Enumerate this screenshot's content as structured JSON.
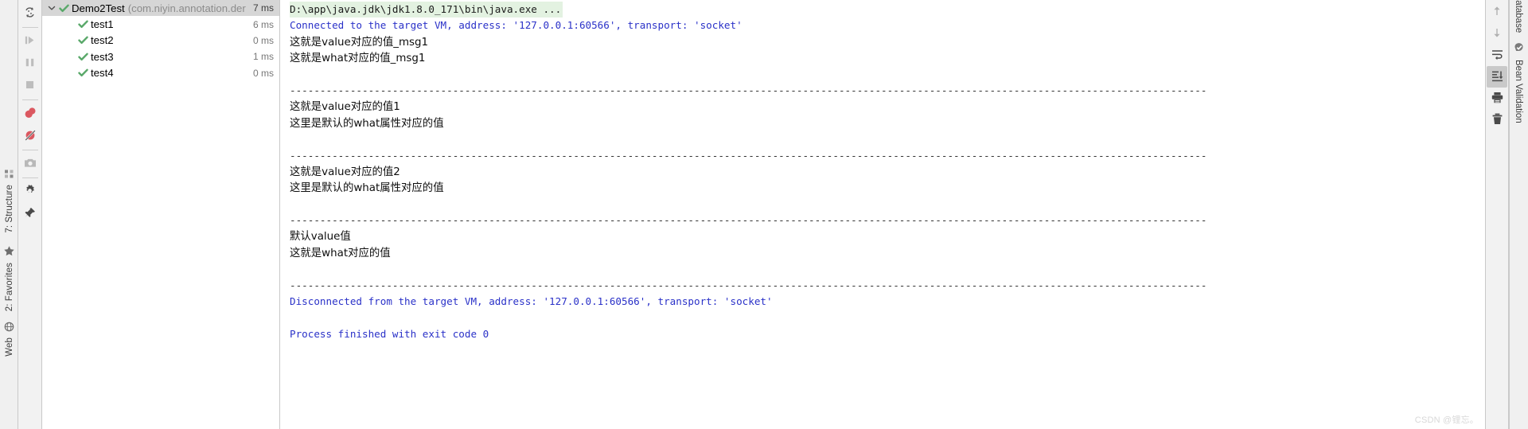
{
  "left_rail": {
    "tabs": [
      {
        "label": "7: Structure",
        "icon": "structure-icon"
      },
      {
        "label": "2: Favorites",
        "icon": "star-icon"
      },
      {
        "label": "Web",
        "icon": "web-icon"
      }
    ]
  },
  "run_toolbar": {
    "buttons": [
      {
        "name": "rerun-tests-button",
        "icon": "rerun-icon",
        "title": "Rerun"
      },
      {
        "name": "run-next-failed-button",
        "icon": "play-pause-icon",
        "title": "Resume Program"
      },
      {
        "name": "pause-button",
        "icon": "pause-icon",
        "title": "Pause Output"
      },
      {
        "name": "stop-button",
        "icon": "stop-icon",
        "title": "Stop"
      },
      {
        "name": "toggle-breakpoints-button",
        "icon": "breakpoints-icon",
        "title": "View Breakpoints"
      },
      {
        "name": "mute-breakpoints-button",
        "icon": "mute-breakpoints-icon",
        "title": "Mute Breakpoints"
      },
      {
        "name": "export-snapshot-button",
        "icon": "camera-icon",
        "title": "Export Test Results"
      },
      {
        "name": "settings-button",
        "icon": "gear-icon",
        "title": "Settings"
      },
      {
        "name": "pin-tab-button",
        "icon": "pin-icon",
        "title": "Pin Tab"
      }
    ]
  },
  "test_tree": {
    "rows": [
      {
        "name": "Demo2Test",
        "package": "(com.niyin.annotation.der",
        "time": "7 ms",
        "status": "passed",
        "selected": true,
        "expanded": true,
        "level": 0
      },
      {
        "name": "test1",
        "package": "",
        "time": "6 ms",
        "status": "passed",
        "selected": false,
        "level": 1
      },
      {
        "name": "test2",
        "package": "",
        "time": "0 ms",
        "status": "passed",
        "selected": false,
        "level": 1
      },
      {
        "name": "test3",
        "package": "",
        "time": "1 ms",
        "status": "passed",
        "selected": false,
        "level": 1
      },
      {
        "name": "test4",
        "package": "",
        "time": "0 ms",
        "status": "passed",
        "selected": false,
        "level": 1
      }
    ]
  },
  "console": {
    "lines": [
      {
        "text": "D:\\app\\java.jdk\\jdk1.8.0_171\\bin\\java.exe ...",
        "style": "cmd"
      },
      {
        "text": "Connected to the target VM, address: '127.0.0.1:60566', transport: 'socket'",
        "style": "sys"
      },
      {
        "text": "这就是value对应的值_msg1",
        "style": "out"
      },
      {
        "text": "这就是what对应的值_msg1",
        "style": "out"
      },
      {
        "text": "",
        "style": "blank"
      },
      {
        "text": "--------------------------------------------------------------------------------------------------------------------------------------------------------",
        "style": "sep"
      },
      {
        "text": "这就是value对应的值1",
        "style": "out"
      },
      {
        "text": "这里是默认的what属性对应的值",
        "style": "out"
      },
      {
        "text": "",
        "style": "blank"
      },
      {
        "text": "--------------------------------------------------------------------------------------------------------------------------------------------------------",
        "style": "sep"
      },
      {
        "text": "这就是value对应的值2",
        "style": "out"
      },
      {
        "text": "这里是默认的what属性对应的值",
        "style": "out"
      },
      {
        "text": "",
        "style": "blank"
      },
      {
        "text": "--------------------------------------------------------------------------------------------------------------------------------------------------------",
        "style": "sep"
      },
      {
        "text": "默认value值",
        "style": "out"
      },
      {
        "text": "这就是what对应的值",
        "style": "out"
      },
      {
        "text": "",
        "style": "blank"
      },
      {
        "text": "--------------------------------------------------------------------------------------------------------------------------------------------------------",
        "style": "sep"
      },
      {
        "text": "Disconnected from the target VM, address: '127.0.0.1:60566', transport: 'socket'",
        "style": "sys"
      },
      {
        "text": "",
        "style": "blank"
      },
      {
        "text": "Process finished with exit code 0",
        "style": "sys"
      }
    ]
  },
  "right_toolbar": {
    "buttons": [
      {
        "name": "previous-occurrence-button",
        "icon": "arrow-up-icon",
        "active": false
      },
      {
        "name": "next-occurrence-button",
        "icon": "arrow-down-icon",
        "active": false
      },
      {
        "name": "soft-wrap-button",
        "icon": "soft-wrap-icon",
        "active": false
      },
      {
        "name": "scroll-to-end-button",
        "icon": "scroll-to-end-icon",
        "active": true
      },
      {
        "name": "print-button",
        "icon": "printer-icon",
        "active": false
      },
      {
        "name": "clear-all-button",
        "icon": "trash-icon",
        "active": false
      }
    ]
  },
  "right_rail": {
    "tabs": [
      {
        "label": "Database",
        "icon": "database-icon"
      },
      {
        "label": "Bean Validation",
        "icon": "bean-validation-icon"
      }
    ]
  },
  "watermark": "CSDN @锂忘。",
  "colors": {
    "pass_green": "#59a869",
    "sys_blue": "#2a31c8",
    "cmd_highlight": "#e3f2e1",
    "selection_gray": "#d6d6d6",
    "package_gray": "#8c8c8c",
    "record_red": "#db5860"
  }
}
